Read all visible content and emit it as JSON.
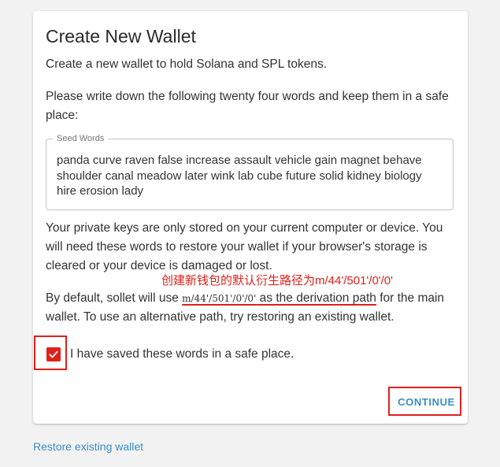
{
  "card": {
    "title": "Create New Wallet",
    "intro": "Create a new wallet to hold Solana and SPL tokens.",
    "instruction": "Please write down the following twenty four words and keep them in a safe place:",
    "seed": {
      "label": "Seed Words",
      "value": "panda curve raven false increase assault vehicle gain magnet behave shoulder canal meadow later wink lab cube future solid kidney biology hire erosion lady"
    },
    "warning": "Your private keys are only stored on your current computer or device. You will need these words to restore your wallet if your browser's storage is cleared or your device is damaged or lost.",
    "annotation": "创建新钱包的默认衍生路径为m/44'/501'/0'/0'",
    "derivation": {
      "prefix": "By default, sollet will use ",
      "path": "m/44'/501'/0'/0'",
      "middle": " as the derivation path",
      "suffix": " for the main wallet. To use an alternative path, try restoring an existing wallet."
    },
    "checkbox": {
      "checked": true,
      "label": "I have saved these words in a safe place."
    },
    "continue_label": "CONTINUE"
  },
  "restore_link": "Restore existing wallet",
  "colors": {
    "accent": "#3b8dc6",
    "highlight": "#e0201b",
    "background": "#f2f2f2",
    "card": "#ffffff"
  }
}
